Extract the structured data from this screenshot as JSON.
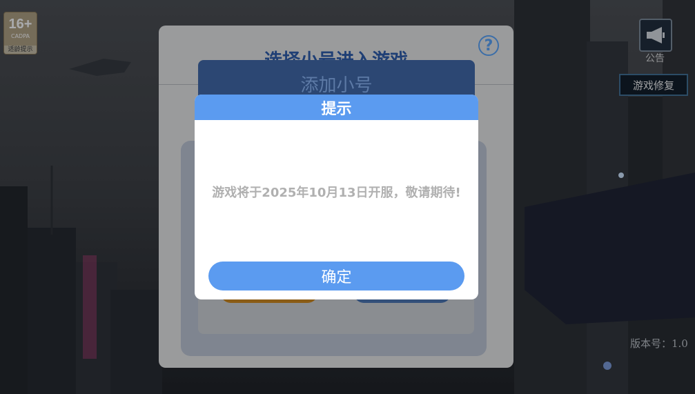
{
  "badge": {
    "age": "16+",
    "org": "CADPA",
    "tip": "适龄提示"
  },
  "sidebar": {
    "notice_label": "公告",
    "repair_label": "游戏修复"
  },
  "version_text": "版本号：1.0",
  "account_panel": {
    "title": "选择小号进入游戏",
    "help_symbol": "?",
    "add_button_label": "添加小号"
  },
  "dialog": {
    "title": "提示",
    "message": "游戏将于2025年10月13日开服，敬请期待!",
    "ok_label": "确定"
  },
  "colors": {
    "dialog_accent": "#5b9bf0",
    "panel_title": "#1f3f75",
    "repair_border": "#3f6f94"
  },
  "icons": {
    "notice": "megaphone-icon",
    "help": "question-circle-icon"
  }
}
